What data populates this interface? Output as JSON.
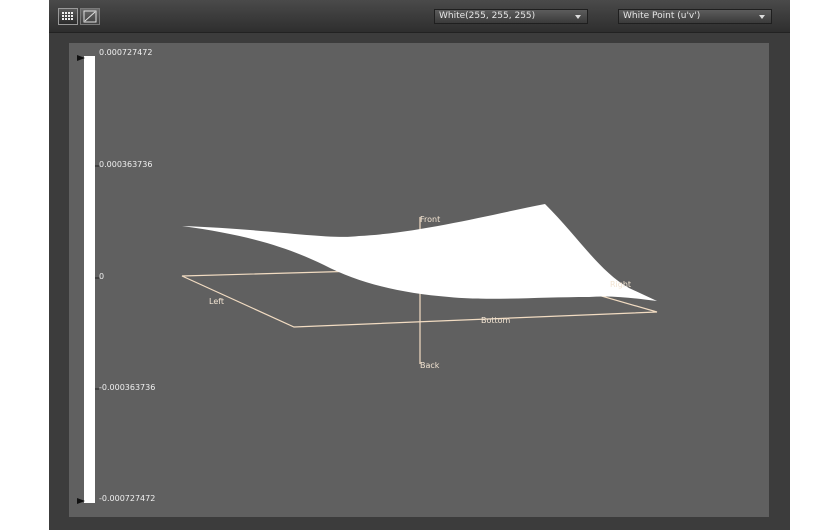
{
  "toolbar": {
    "grid_view_icon": "grid-icon",
    "curve_view_icon": "curve-icon",
    "color_select": {
      "value": "White(255, 255, 255)"
    },
    "measure_select": {
      "value": "White Point (u'v')"
    }
  },
  "colorbar": {
    "ticks": [
      "0.000727472",
      "0.000363736",
      "0",
      "-0.000363736",
      "-0.000727472"
    ],
    "max": 0.000727472,
    "min": -0.000727472
  },
  "plot": {
    "axis_labels": {
      "front": "Front",
      "back": "Back",
      "left": "Left",
      "right": "Right",
      "bottom": "Bottom"
    },
    "surface_color": "#ffffff",
    "frame_color": "#f2dcc2",
    "background_color": "#606060"
  }
}
